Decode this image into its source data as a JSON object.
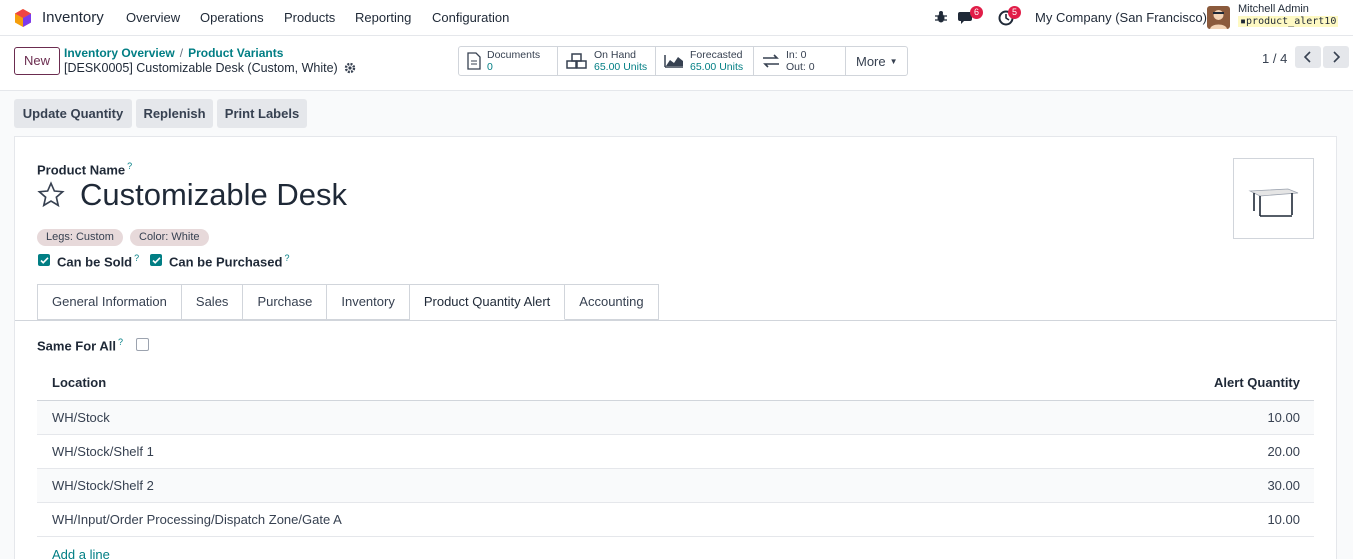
{
  "navbar": {
    "app_name": "Inventory",
    "menu": [
      "Overview",
      "Operations",
      "Products",
      "Reporting",
      "Configuration"
    ],
    "messages_badge": "6",
    "activities_badge": "5",
    "company": "My Company (San Francisco)",
    "user_name": "Mitchell Admin",
    "database": "product_alert10"
  },
  "control": {
    "new_label": "New",
    "breadcrumb": [
      "Inventory Overview",
      "Product Variants"
    ],
    "record_title": "[DESK0005] Customizable Desk (Custom, White)",
    "smart_buttons": {
      "documents": {
        "label": "Documents",
        "value": "0"
      },
      "on_hand": {
        "label": "On Hand",
        "value": "65.00 Units"
      },
      "forecasted": {
        "label": "Forecasted",
        "value": "65.00 Units"
      },
      "in_out": {
        "in": "In: 0",
        "out": "Out: 0"
      },
      "more": "More"
    },
    "pager": "1 / 4"
  },
  "actions": [
    "Update Quantity",
    "Replenish",
    "Print Labels"
  ],
  "form": {
    "product_name_label": "Product Name",
    "product_name": "Customizable Desk",
    "attribute_tags": [
      "Legs: Custom",
      "Color: White"
    ],
    "can_be_sold": {
      "label": "Can be Sold",
      "checked": true
    },
    "can_be_purchased": {
      "label": "Can be Purchased",
      "checked": true
    },
    "tabs": [
      "General Information",
      "Sales",
      "Purchase",
      "Inventory",
      "Product Quantity Alert",
      "Accounting"
    ],
    "active_tab": "Product Quantity Alert",
    "same_for_all": {
      "label": "Same For All",
      "checked": false
    },
    "table": {
      "headers": {
        "location": "Location",
        "alert_quantity": "Alert Quantity"
      },
      "rows": [
        {
          "location": "WH/Stock",
          "qty": "10.00"
        },
        {
          "location": "WH/Stock/Shelf 1",
          "qty": "20.00"
        },
        {
          "location": "WH/Stock/Shelf 2",
          "qty": "30.00"
        },
        {
          "location": "WH/Input/Order Processing/Dispatch Zone/Gate A",
          "qty": "10.00"
        }
      ],
      "add_line": "Add a line"
    }
  },
  "colors": {
    "accent": "#017e84",
    "brand": "#6b2c4f",
    "badge": "#e11d48"
  }
}
